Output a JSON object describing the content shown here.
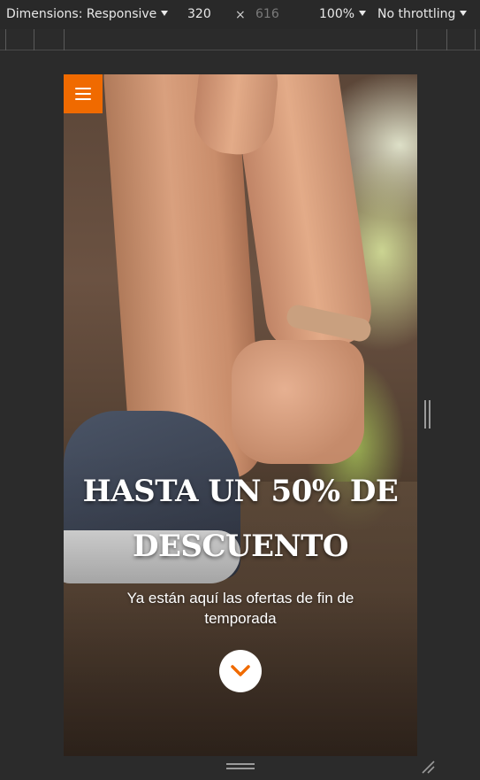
{
  "devtools": {
    "dimensions_label": "Dimensions: Responsive",
    "width_value": "320",
    "times_symbol": "×",
    "height_value": "616",
    "zoom": "100%",
    "throttling": "No throttling"
  },
  "hero": {
    "headline": "HASTA UN 50% DE DESCUENTO",
    "subtext": "Ya están aquí las ofertas de fin de temporada"
  },
  "colors": {
    "accent": "#f06a00",
    "devtools_bg": "#292929"
  },
  "icons": {
    "menu": "hamburger-menu-icon",
    "scroll": "chevron-down-icon",
    "resize_right": "vertical-grip-icon",
    "resize_bottom": "horizontal-grip-icon",
    "resize_corner": "corner-resize-icon"
  }
}
